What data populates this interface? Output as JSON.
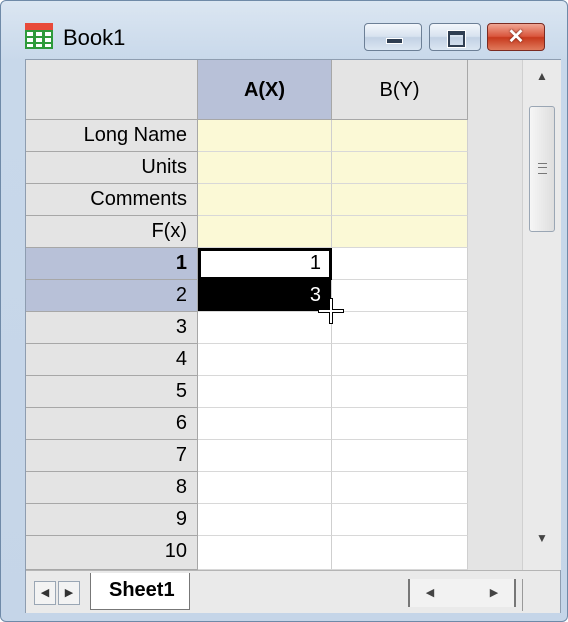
{
  "window": {
    "title": "Book1",
    "caption_buttons": {
      "minimize": "",
      "maximize": "",
      "close": "✕"
    }
  },
  "grid": {
    "columns": [
      {
        "label": "A(X)",
        "selected": true
      },
      {
        "label": "B(Y)",
        "selected": false
      }
    ],
    "meta_rows": [
      {
        "label": "Long Name",
        "a": "",
        "b": ""
      },
      {
        "label": "Units",
        "a": "",
        "b": ""
      },
      {
        "label": "Comments",
        "a": "",
        "b": ""
      },
      {
        "label": "F(x)",
        "a": "",
        "b": ""
      }
    ],
    "data_rows": [
      {
        "label": "1",
        "a": "1",
        "b": ""
      },
      {
        "label": "2",
        "a": "3",
        "b": ""
      },
      {
        "label": "3",
        "a": "",
        "b": ""
      },
      {
        "label": "4",
        "a": "",
        "b": ""
      },
      {
        "label": "5",
        "a": "",
        "b": ""
      },
      {
        "label": "6",
        "a": "",
        "b": ""
      },
      {
        "label": "7",
        "a": "",
        "b": ""
      },
      {
        "label": "8",
        "a": "",
        "b": ""
      },
      {
        "label": "9",
        "a": "",
        "b": ""
      },
      {
        "label": "10",
        "a": "",
        "b": ""
      }
    ]
  },
  "sheet_tabs": [
    "Sheet1"
  ],
  "icons": {
    "app": "worksheet-icon",
    "scroll_up": "▲",
    "scroll_down": "▼",
    "scroll_left": "◀",
    "scroll_right": "▶",
    "tab_prev": "◀",
    "tab_next": "▶"
  },
  "colors": {
    "column_selected": "#b8c1d8",
    "meta_fill": "#fbf9d6",
    "header_fill": "#e4e4e4"
  }
}
